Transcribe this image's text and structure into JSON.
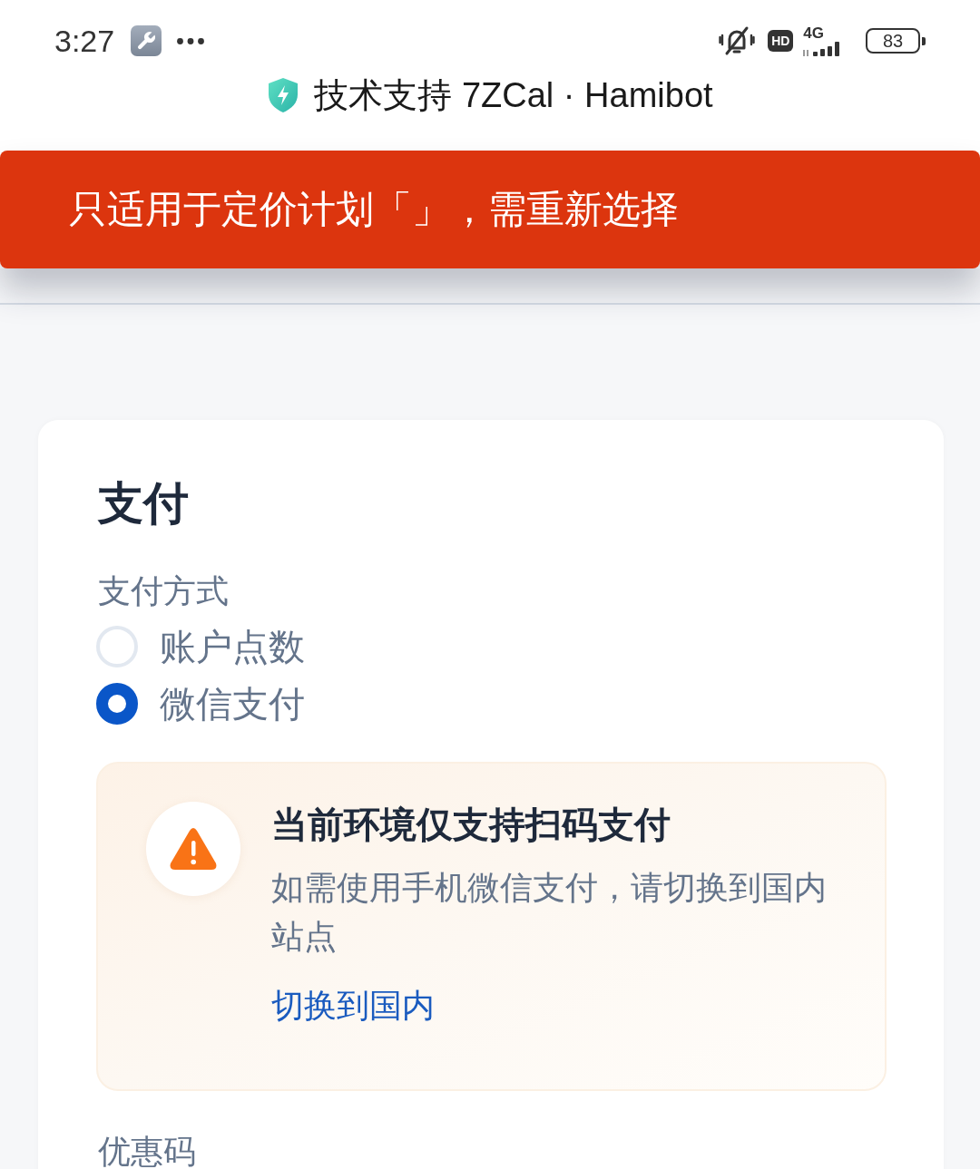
{
  "status_bar": {
    "time": "3:27",
    "hd_badge": "HD",
    "network": "4G",
    "battery": "83"
  },
  "page_title": {
    "text": "技术支持 7ZCal · Hamibot"
  },
  "toast": {
    "message": "只适用于定价计划「」，需重新选择"
  },
  "payment": {
    "heading": "支付",
    "method_label": "支付方式",
    "options": [
      {
        "label": "账户点数",
        "selected": false
      },
      {
        "label": "微信支付",
        "selected": true
      }
    ],
    "notice": {
      "title": "当前环境仅支持扫码支付",
      "body": "如需使用手机微信支付，请切换到国内站点",
      "link": "切换到国内"
    },
    "coupon_label": "优惠码"
  }
}
